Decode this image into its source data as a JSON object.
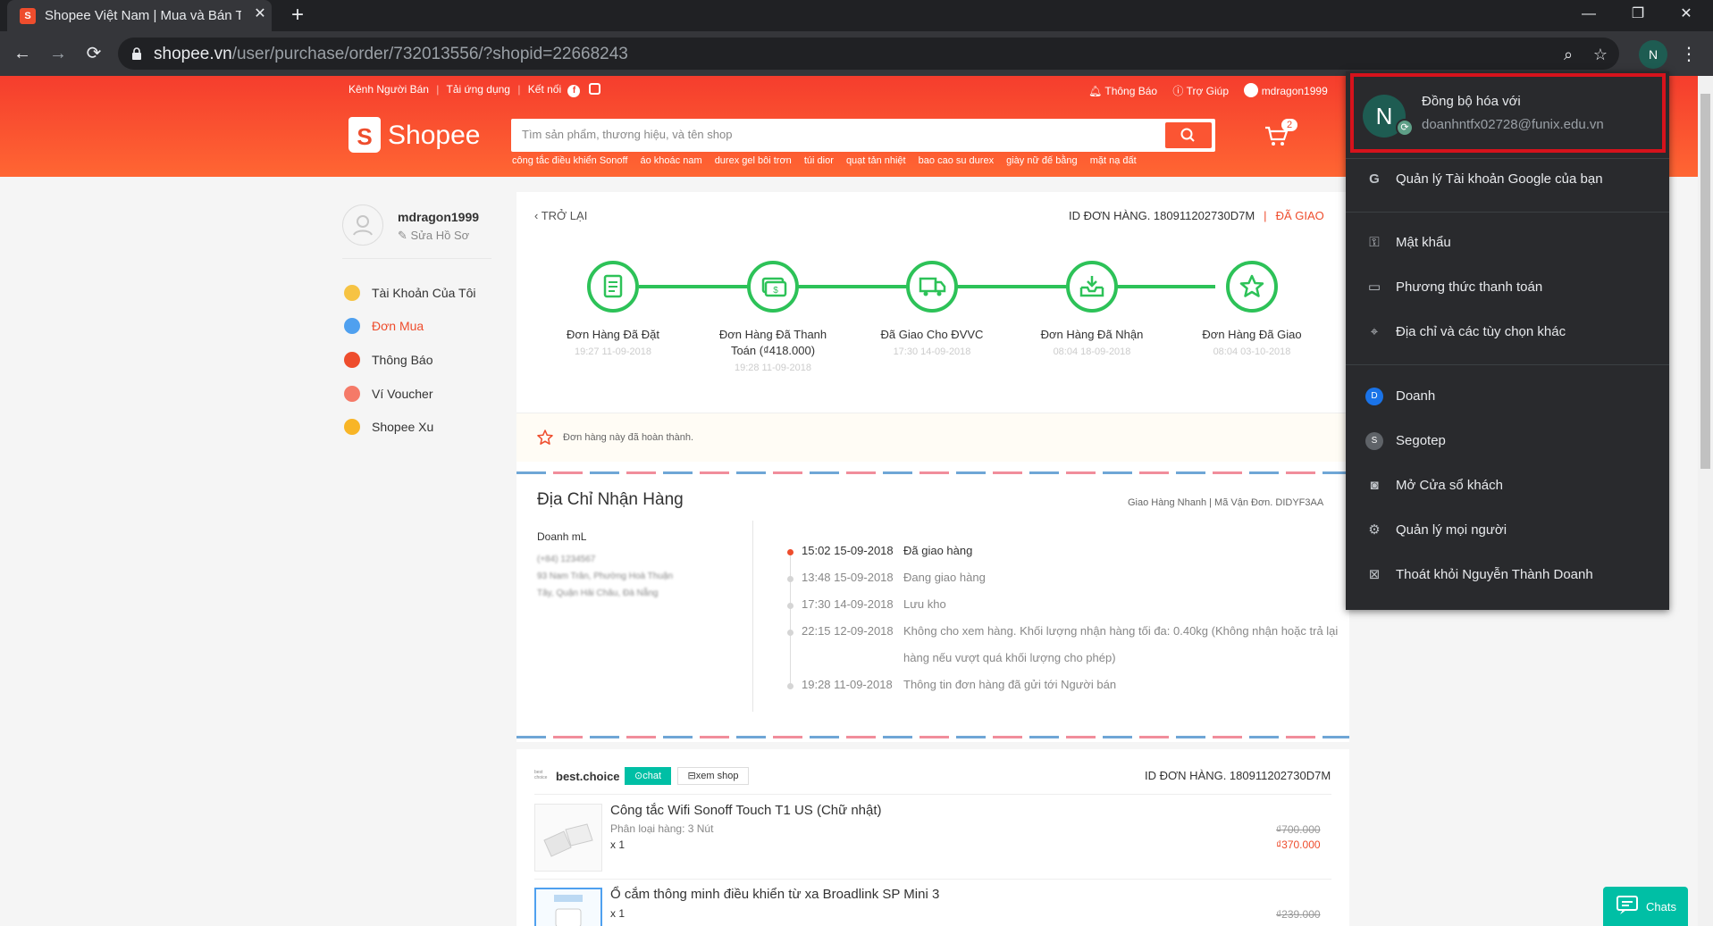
{
  "browser": {
    "tab_title": "Shopee Việt Nam | Mua và Bán Tr",
    "url_host": "shopee.vn",
    "url_path": "/user/purchase/order/732013556/?shopid=22668243",
    "profile_initial": "N"
  },
  "shopee_header": {
    "topnav_left": [
      "Kênh Người Bán",
      "Tải ứng dụng",
      "Kết nối"
    ],
    "topnav_right": {
      "notifications": "Thông Báo",
      "help": "Trợ Giúp",
      "username": "mdragon1999"
    },
    "logo_text": "Shopee",
    "search_placeholder": "Tìm sản phẩm, thương hiệu, và tên shop",
    "keywords": [
      "công tắc điều khiển Sonoff",
      "áo khoác nam",
      "durex gel bôi trơn",
      "túi dior",
      "quạt tản nhiệt",
      "bao cao su durex",
      "giày nữ đế bằng",
      "mặt nạ đất"
    ],
    "cart_count": "2"
  },
  "sidebar": {
    "username": "mdragon1999",
    "edit_profile": "✎ Sửa Hồ Sơ",
    "items": [
      {
        "label": "Tài Khoản Của Tôi",
        "color": "#f6c343"
      },
      {
        "label": "Đơn Mua",
        "color": "#4fa0ef"
      },
      {
        "label": "Thông Báo",
        "color": "#ee4d2d"
      },
      {
        "label": "Ví Voucher",
        "color": "#f57a68"
      },
      {
        "label": "Shopee Xu",
        "color": "#f8b526"
      }
    ],
    "active_item": "Đơn Mua"
  },
  "order": {
    "back": "TRỞ LẠI",
    "order_id": "ID ĐƠN HÀNG. 180911202730D7M",
    "status": "ĐÃ GIAO",
    "steps": [
      {
        "label": "Đơn Hàng Đã Đặt",
        "time": "19:27 11-09-2018"
      },
      {
        "label": "Đơn Hàng Đã Thanh Toán (₫418.000)",
        "time": "19:28 11-09-2018"
      },
      {
        "label": "Đã Giao Cho ĐVVC",
        "time": "17:30 14-09-2018"
      },
      {
        "label": "Đơn Hàng Đã Nhận",
        "time": "08:04 18-09-2018"
      },
      {
        "label": "Đơn Hàng Đã Giao",
        "time": "08:04 03-10-2018"
      }
    ],
    "done_note": "Đơn hàng này đã hoàn thành."
  },
  "address": {
    "title": "Địa Chỉ Nhận Hàng",
    "carrier": "Giao Hàng Nhanh | Mã Vận Đơn. DIDYF3AA",
    "name": "Doanh mL",
    "line_phone": "(+84) 1234567",
    "line_street": "93 Nam Trân, Phường Hoà Thuận",
    "line_city": "Tây, Quận Hải Châu, Đà Nẵng"
  },
  "tracking": [
    {
      "time": "15:02 15-09-2018",
      "text": "Đã giao hàng",
      "active": true
    },
    {
      "time": "13:48 15-09-2018",
      "text": "Đang giao hàng",
      "active": false
    },
    {
      "time": "17:30 14-09-2018",
      "text": "Lưu kho",
      "active": false
    },
    {
      "time": "22:15 12-09-2018",
      "text": "Không cho xem hàng. Khối lượng nhận hàng tối đa: 0.40kg (Không nhận hoặc trả lại hàng nếu vượt quá khối lượng cho phép)",
      "active": false
    },
    {
      "time": "19:28 11-09-2018",
      "text": "Thông tin đơn hàng đã gửi tới Người bán",
      "active": false
    }
  ],
  "shop": {
    "logo_text": "best choice",
    "name": "best.choice",
    "chat": "chat",
    "view_shop": "xem shop",
    "order_id": "ID ĐƠN HÀNG. 180911202730D7M"
  },
  "products": [
    {
      "name": "Công tắc Wifi Sonoff Touch T1 US (Chữ nhật)",
      "variant": "Phân loại hàng: 3 Nút",
      "qty": "x 1",
      "old_price": "₫700.000",
      "new_price": "₫370.000"
    },
    {
      "name": "Ổ cắm thông minh điều khiển từ xa Broadlink SP Mini 3",
      "variant": "",
      "qty": "x 1",
      "old_price": "₫239.000",
      "new_price": ""
    }
  ],
  "chats_label": "Chats",
  "profile_menu": {
    "initial": "N",
    "sync_title": "Đồng bộ hóa với",
    "sync_email": "doanhntfx02728@funix.edu.vn",
    "google_account": "Quản lý Tài khoản Google của bạn",
    "items_autofill": [
      "Mật khẩu",
      "Phương thức thanh toán",
      "Địa chỉ và các tùy chọn khác"
    ],
    "people": [
      {
        "initial": "D",
        "name": "Doanh",
        "color": "#1a73e8"
      },
      {
        "initial": "S",
        "name": "Segotep",
        "color": "#5f6368"
      }
    ],
    "guest": "Mở Cửa sổ khách",
    "manage_people": "Quản lý mọi người",
    "sign_out": "Thoát khỏi Nguyễn Thành Doanh"
  }
}
